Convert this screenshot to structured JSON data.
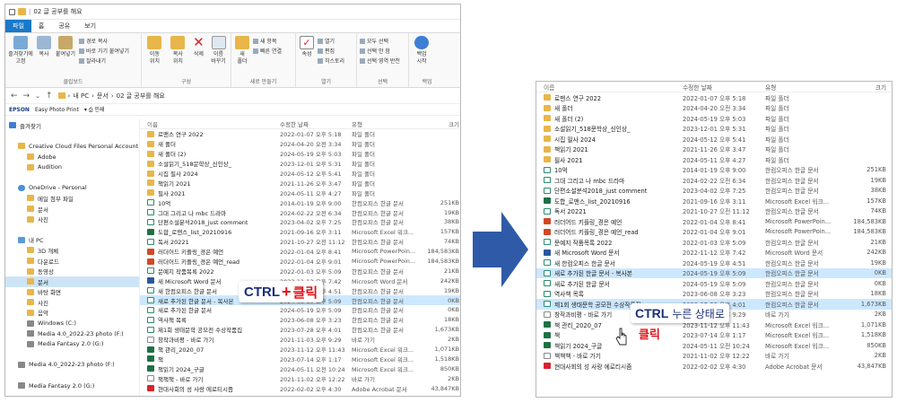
{
  "left_window": {
    "title": "02 글 공부를 해요",
    "ribbon_tabs": [
      "파일",
      "홈",
      "공유",
      "보기"
    ],
    "ribbon": {
      "clipboard": {
        "label": "클립보드",
        "pin": "즐겨찾기에\n고정",
        "copy": "복사",
        "paste": "붙여넣기",
        "small": [
          "경로 복사",
          "바로 가기 붙여넣기",
          "잘라내기"
        ]
      },
      "organize": {
        "label": "구성",
        "move": "이동\n위치",
        "copyto": "복사\n위치",
        "delete": "삭제",
        "rename": "이름\n바꾸기"
      },
      "new": {
        "label": "새로 만들기",
        "newfolder": "새\n폴더",
        "small": [
          "새 항목",
          "빠른 연결"
        ]
      },
      "open": {
        "label": "열기",
        "props": "속성",
        "small": [
          "열기",
          "편집",
          "히스토리"
        ]
      },
      "select": {
        "label": "선택",
        "small": [
          "모두 선택",
          "선택 안 함",
          "선택 영역 반전"
        ]
      },
      "backup": {
        "label": "백업",
        "start": "백업\n시작"
      }
    },
    "address": [
      "내 PC",
      "문서",
      "02 글 공부를 해요"
    ],
    "epson_bar": [
      "Easy Photo Print",
      "인쇄"
    ],
    "nav_items": [
      {
        "label": "즐겨찾기",
        "icon": "star-icon",
        "indent": 0
      },
      {
        "label": "",
        "icon": "",
        "indent": 0
      },
      {
        "label": "Creative Cloud Files Personal Account giznot",
        "icon": "folder-icon",
        "indent": 1
      },
      {
        "label": "Adobe",
        "icon": "folder-icon",
        "indent": 2
      },
      {
        "label": "Audition",
        "icon": "folder-icon",
        "indent": 2
      },
      {
        "label": "",
        "icon": "",
        "indent": 0
      },
      {
        "label": "OneDrive - Personal",
        "icon": "cloud-icon",
        "indent": 1
      },
      {
        "label": "메일 첨부 파일",
        "icon": "folder-icon",
        "indent": 2
      },
      {
        "label": "문서",
        "icon": "folder-icon",
        "indent": 2
      },
      {
        "label": "사진",
        "icon": "folder-icon",
        "indent": 2
      },
      {
        "label": "",
        "icon": "",
        "indent": 0
      },
      {
        "label": "내 PC",
        "icon": "pc-icon",
        "indent": 1
      },
      {
        "label": "3D 개체",
        "icon": "folder-icon",
        "indent": 2
      },
      {
        "label": "다운로드",
        "icon": "folder-icon",
        "indent": 2
      },
      {
        "label": "동영상",
        "icon": "folder-icon",
        "indent": 2
      },
      {
        "label": "문서",
        "icon": "folder-icon",
        "indent": 2,
        "selected": true
      },
      {
        "label": "바탕 화면",
        "icon": "folder-icon",
        "indent": 2
      },
      {
        "label": "사진",
        "icon": "folder-icon",
        "indent": 2
      },
      {
        "label": "음악",
        "icon": "folder-icon",
        "indent": 2
      },
      {
        "label": "Windows (C:)",
        "icon": "disk-icon",
        "indent": 2
      },
      {
        "label": "Media 4.0_2022-23 photo (F:)",
        "icon": "disk-icon",
        "indent": 2
      },
      {
        "label": "Media Fantasy 2.0 (G:)",
        "icon": "disk-icon",
        "indent": 2
      },
      {
        "label": "",
        "icon": "",
        "indent": 0
      },
      {
        "label": "Media 4.0_2022-23 photo (F:)",
        "icon": "disk-icon",
        "indent": 1
      },
      {
        "label": "",
        "icon": "",
        "indent": 0
      },
      {
        "label": "Media Fantasy 2.0 (G:)",
        "icon": "disk-icon",
        "indent": 1
      },
      {
        "label": "",
        "icon": "",
        "indent": 0
      },
      {
        "label": "네트워크",
        "icon": "net-icon",
        "indent": 1
      }
    ],
    "columns": [
      "이름",
      "수정한 날짜",
      "유형",
      "크기"
    ],
    "files": [
      {
        "name": "로맨스 연구 2022",
        "date": "2022-01-07 오후 5:18",
        "type": "파일 폴더",
        "size": "",
        "icon": "folder"
      },
      {
        "name": "새 폴더",
        "date": "2024-04-20 오전 3:34",
        "type": "파일 폴더",
        "size": "",
        "icon": "folder"
      },
      {
        "name": "새 폴더 (2)",
        "date": "2024-05-19 오후 5:03",
        "type": "파일 폴더",
        "size": "",
        "icon": "folder"
      },
      {
        "name": "소설읽기_518문학상_신인상_",
        "date": "2023-12-01 오후 5:31",
        "type": "파일 폴더",
        "size": "",
        "icon": "folder"
      },
      {
        "name": "시집 필사 2024",
        "date": "2024-05-12 오후 5:41",
        "type": "파일 폴더",
        "size": "",
        "icon": "folder"
      },
      {
        "name": "책읽기 2021",
        "date": "2021-11-26 오후 3:47",
        "type": "파일 폴더",
        "size": "",
        "icon": "folder"
      },
      {
        "name": "필사 2021",
        "date": "2024-05-11 오후 4:27",
        "type": "파일 폴더",
        "size": "",
        "icon": "folder"
      },
      {
        "name": "10억",
        "date": "2014-01-19 오후 9:00",
        "type": "한컴오피스 한글 문서",
        "size": "251KB",
        "icon": "hwp"
      },
      {
        "name": "그대 그리고 나 mbc 드라마",
        "date": "2024-02-22 오전 6:34",
        "type": "한컴오피스 한글 문서",
        "size": "19KB",
        "icon": "hwp"
      },
      {
        "name": "단편소설분석2018_just comment",
        "date": "2023-04-02 오후 7:25",
        "type": "한컴오피스 한글 문서",
        "size": "38KB",
        "icon": "hwp"
      },
      {
        "name": "도합_로맨스_list_20210916",
        "date": "2021-09-16 오후 3:11",
        "type": "Microsoft Excel 워크...",
        "size": "157KB",
        "icon": "xls"
      },
      {
        "name": "독서 20221",
        "date": "2021-10-27 오전 11:12",
        "type": "한컴오피스 한글 문서",
        "size": "74KB",
        "icon": "hwp"
      },
      {
        "name": "러더어드 키플링_경은 예언",
        "date": "2022-01-04 오후 8:41",
        "type": "Microsoft PowerPoin...",
        "size": "184,583KB",
        "icon": "ppt"
      },
      {
        "name": "러더어드 키플링_경은 예언_read",
        "date": "2022-01-04 오후 9:01",
        "type": "Microsoft PowerPoin...",
        "size": "184,583KB",
        "icon": "ppt"
      },
      {
        "name": "문예지 작품목록 2022",
        "date": "2022-01-03 오후 5:09",
        "type": "한컴오피스 한글 문서",
        "size": "21KB",
        "icon": "hwp"
      },
      {
        "name": "새 Microsoft Word 문서",
        "date": "2022-11-12 오후 7:42",
        "type": "Microsoft Word 문서",
        "size": "242KB",
        "icon": "doc"
      },
      {
        "name": "새 한컴오피스 한글 문서",
        "date": "2024-05-19 오후 4:51",
        "type": "한컴오피스 한글 문서",
        "size": "19KB",
        "icon": "hwp"
      },
      {
        "name": "새로 추가된 한글 문서 - 복사본",
        "date": "2024-05-19 오후 5:09",
        "type": "한컴오피스 한글 문서",
        "size": "0KB",
        "icon": "hwp",
        "selected": true
      },
      {
        "name": "새로 추가된 한글 문서",
        "date": "2024-05-19 오후 5:09",
        "type": "한컴오피스 한글 문서",
        "size": "0KB",
        "icon": "hwp"
      },
      {
        "name": "역사책 목록",
        "date": "2023-06-08 오후 3:23",
        "type": "한컴오피스 한글 문서",
        "size": "18KB",
        "icon": "hwp"
      },
      {
        "name": "제1회 생태문학 공모전 수상작품집",
        "date": "2023-07-28 오후 4:01",
        "type": "한컴오피스 한글 문서",
        "size": "1,673KB",
        "icon": "hwp"
      },
      {
        "name": "창작과비평 - 바로 가기",
        "date": "2021-11-03 오후 9:29",
        "type": "바로 가기",
        "size": "2KB",
        "icon": "lnk"
      },
      {
        "name": "책 관리_2020_07",
        "date": "2023-11-12 오후 11:43",
        "type": "Microsoft Excel 워크...",
        "size": "1,071KB",
        "icon": "xls"
      },
      {
        "name": "책",
        "date": "2023-07-14 오후 1:17",
        "type": "Microsoft Excel 워크...",
        "size": "1,518KB",
        "icon": "xls"
      },
      {
        "name": "책읽기 2024_구글",
        "date": "2024-05-11 오전 10:24",
        "type": "Microsoft Excel 워크...",
        "size": "850KB",
        "icon": "xls"
      },
      {
        "name": "책책책 - 바로 가기",
        "date": "2021-11-02 오후 12:22",
        "type": "바로 가기",
        "size": "2KB",
        "icon": "lnk"
      },
      {
        "name": "현대사회의 성 사랑 에로티시즘",
        "date": "2022-02-02 오후 4:30",
        "type": "Adobe Acrobat 문서",
        "size": "43,847KB",
        "icon": "pdf"
      }
    ]
  },
  "right_window": {
    "columns": [
      "이름",
      "수정한 날짜",
      "유형",
      "크기"
    ],
    "files": [
      {
        "name": "로맨스 연구 2022",
        "date": "2022-01-07 오후 5:18",
        "type": "파일 폴더",
        "size": "",
        "icon": "folder"
      },
      {
        "name": "새 폴더",
        "date": "2024-04-20 오전 3:34",
        "type": "파일 폴더",
        "size": "",
        "icon": "folder"
      },
      {
        "name": "새 폴더 (2)",
        "date": "2024-05-19 오후 5:03",
        "type": "파일 폴더",
        "size": "",
        "icon": "folder"
      },
      {
        "name": "소설읽기_518문학상_신인상_",
        "date": "2023-12-01 오후 5:31",
        "type": "파일 폴더",
        "size": "",
        "icon": "folder"
      },
      {
        "name": "시집 필사 2024",
        "date": "2024-05-12 오후 5:41",
        "type": "파일 폴더",
        "size": "",
        "icon": "folder"
      },
      {
        "name": "책읽기 2021",
        "date": "2021-11-26 오후 3:47",
        "type": "파일 폴더",
        "size": "",
        "icon": "folder"
      },
      {
        "name": "필사 2021",
        "date": "2024-05-11 오후 4:27",
        "type": "파일 폴더",
        "size": "",
        "icon": "folder"
      },
      {
        "name": "10억",
        "date": "2014-01-19 오후 9:00",
        "type": "한컴오피스 한글 문서",
        "size": "251KB",
        "icon": "hwp"
      },
      {
        "name": "그대 그리고 나 mbc 드라마",
        "date": "2024-02-22 오전 6:34",
        "type": "한컴오피스 한글 문서",
        "size": "19KB",
        "icon": "hwp"
      },
      {
        "name": "단편소설분석2018_just comment",
        "date": "2023-04-02 오후 7:25",
        "type": "한컴오피스 한글 문서",
        "size": "38KB",
        "icon": "hwp"
      },
      {
        "name": "도합_로맨스_list_20210916",
        "date": "2021-09-16 오후 3:11",
        "type": "Microsoft Excel 워크...",
        "size": "157KB",
        "icon": "xls"
      },
      {
        "name": "독서 20221",
        "date": "2021-10-27 오전 11:12",
        "type": "한컴오피스 한글 문서",
        "size": "74KB",
        "icon": "hwp"
      },
      {
        "name": "러더어드 키플링_경은 예언",
        "date": "2022-01-04 오후 8:41",
        "type": "Microsoft PowerPoin...",
        "size": "184,583KB",
        "icon": "ppt"
      },
      {
        "name": "러더어드 키플링_경은 예언_read",
        "date": "2022-01-04 오후 9:01",
        "type": "Microsoft PowerPoin...",
        "size": "184,583KB",
        "icon": "ppt"
      },
      {
        "name": "문예지 작품목록 2022",
        "date": "2022-01-03 오후 5:09",
        "type": "한컴오피스 한글 문서",
        "size": "21KB",
        "icon": "hwp"
      },
      {
        "name": "새 Microsoft Word 문서",
        "date": "2022-11-12 오후 7:42",
        "type": "Microsoft Word 문서",
        "size": "242KB",
        "icon": "doc"
      },
      {
        "name": "새 한컴오피스 한글 문서",
        "date": "2024-05-19 오후 4:51",
        "type": "한컴오피스 한글 문서",
        "size": "19KB",
        "icon": "hwp"
      },
      {
        "name": "새로 추가된 한글 문서 - 복사본",
        "date": "2024-05-19 오후 5:09",
        "type": "한컴오피스 한글 문서",
        "size": "0KB",
        "icon": "hwp",
        "selected": true
      },
      {
        "name": "새로 추가된 한글 문서",
        "date": "2024-05-19 오후 5:09",
        "type": "한컴오피스 한글 문서",
        "size": "0KB",
        "icon": "hwp"
      },
      {
        "name": "역사책 목록",
        "date": "2023-06-08 오후 3:23",
        "type": "한컴오피스 한글 문서",
        "size": "18KB",
        "icon": "hwp"
      },
      {
        "name": "제1회 생태문학 공모전 수상작품집",
        "date": "2023-07-28 오후 4:01",
        "type": "한컴오피스 한글 문서",
        "size": "1,673KB",
        "icon": "hwp",
        "selected": true
      },
      {
        "name": "창작과비평 - 바로 가기",
        "date": "2021-11-03 오후 9:29",
        "type": "바로 가기",
        "size": "2KB",
        "icon": "lnk"
      },
      {
        "name": "책 관리_2020_07",
        "date": "2023-11-12 오후 11:43",
        "type": "Microsoft Excel 워크...",
        "size": "1,071KB",
        "icon": "xls"
      },
      {
        "name": "책",
        "date": "2023-07-14 오후 1:17",
        "type": "Microsoft Excel 워크...",
        "size": "1,518KB",
        "icon": "xls"
      },
      {
        "name": "책읽기 2024_구글",
        "date": "2024-05-11 오전 10:24",
        "type": "Microsoft Excel 워크...",
        "size": "850KB",
        "icon": "xls"
      },
      {
        "name": "책책책 - 바로 가기",
        "date": "2021-11-02 오후 12:22",
        "type": "바로 가기",
        "size": "2KB",
        "icon": "lnk"
      },
      {
        "name": "현대사회의 성 사랑 에로티시즘",
        "date": "2022-02-02 오후 4:30",
        "type": "Adobe Acrobat 문서",
        "size": "43,847KB",
        "icon": "pdf"
      }
    ]
  },
  "callouts": {
    "left": {
      "ctrl": "CTRL",
      "plus": "+",
      "click": "클릭"
    },
    "right": {
      "ctrl": "CTRL",
      "state": "누른 상태로",
      "click": "클릭"
    }
  },
  "colors": {
    "selection": "#cce8ff",
    "file_tab": "#1979ca",
    "arrow": "#2f5aa8",
    "callout_red": "#e0141b",
    "callout_navy": "#1b2f7a"
  }
}
